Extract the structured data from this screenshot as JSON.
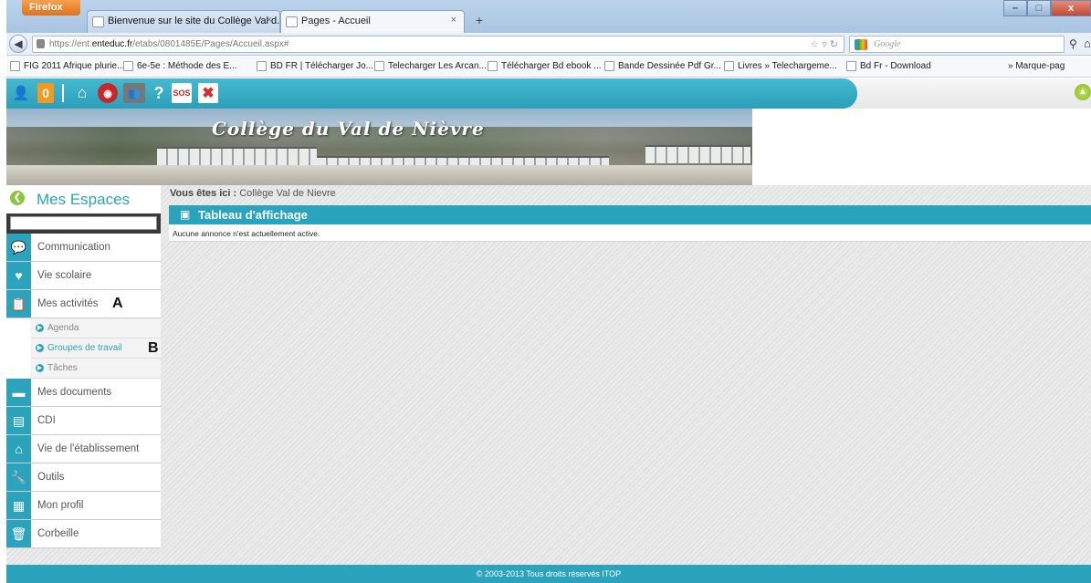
{
  "browser": {
    "menu_button": "Firefox",
    "tabs": [
      {
        "label": "Bienvenue sur le site du Collège Val d...",
        "close": "×"
      },
      {
        "label": "Pages - Accueil",
        "close": "×"
      }
    ],
    "new_tab": "+",
    "url_host": "https://ent.",
    "url_domain": "enteduc.fr",
    "url_path": "/etabs/0801485E/Pages/Accueil.aspx#",
    "search_placeholder": "Google",
    "bookmarks": [
      "FIG 2011 Afrique plurie...",
      "6e-5e : Méthode des E...",
      "BD FR | Télécharger Jo...",
      "Telecharger Les Arcan...",
      "Télécharger Bd ebook ...",
      "Bande Dessinée Pdf Gr...",
      "Livres » Telechargeme...",
      "Bd Fr - Download"
    ],
    "bookmarks_more": "» Marque-pag"
  },
  "toolbar": {
    "notification_count": "0",
    "sos_label": "SOS"
  },
  "banner": {
    "title": "Collège du Val de Nièvre"
  },
  "sidebar": {
    "title": "Mes Espaces",
    "search_value": "",
    "items": [
      {
        "label": "Communication",
        "icon": "chat-icon"
      },
      {
        "label": "Vie scolaire",
        "icon": "heart-icon"
      },
      {
        "label": "Mes activités",
        "icon": "clipboard-icon",
        "marker": "A"
      },
      {
        "label": "Mes documents",
        "icon": "folder-icon"
      },
      {
        "label": "CDI",
        "icon": "book-icon"
      },
      {
        "label": "Vie de l'établissement",
        "icon": "home-icon"
      },
      {
        "label": "Outils",
        "icon": "wrench-icon"
      },
      {
        "label": "Mon profil",
        "icon": "profile-icon"
      },
      {
        "label": "Corbeille",
        "icon": "trash-icon"
      }
    ],
    "subitems": [
      {
        "label": "Agenda"
      },
      {
        "label": "Groupes de travail",
        "marker": "B"
      },
      {
        "label": "Tâches"
      }
    ]
  },
  "breadcrumb": {
    "prefix": "Vous êtes ici :",
    "location": "Collège Val de Nievre"
  },
  "board": {
    "title": "Tableau d'affichage",
    "message": "Aucune annonce n'est actuellement active."
  },
  "footer": {
    "text": "© 2003-2013 Tous droits réservés ITOP"
  },
  "colors": {
    "accent": "#2ba3bd",
    "notification": "#f39a1e",
    "back_button": "#8cc63f"
  }
}
